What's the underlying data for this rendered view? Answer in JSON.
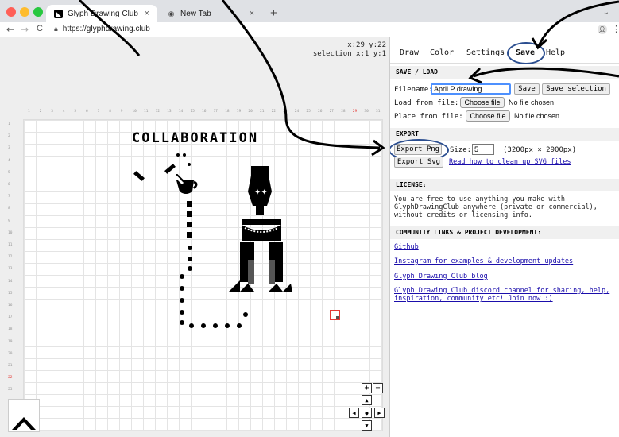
{
  "browser": {
    "tabs": [
      {
        "label": "Glyph Drawing Club",
        "active": true,
        "close": "×"
      },
      {
        "label": "New Tab",
        "active": false,
        "close": "×"
      }
    ],
    "new_tab": "+",
    "tab_chevron": "⌄",
    "url": "https://glyphdrawing.club",
    "nav": {
      "back": "←",
      "forward": "→",
      "reload": "C"
    },
    "icons": [
      "lock-icon",
      "profile-icon",
      "kebab-menu-icon"
    ]
  },
  "canvas": {
    "cursor_line1": "x:29 y:22",
    "cursor_line2": "selection x:1 y:1",
    "highlight_column": "29",
    "highlight_row": "22",
    "title": "COLLABORATION",
    "zoom_in": "+",
    "zoom_out": "−",
    "pan": {
      "up": "▲",
      "down": "▼",
      "left": "◀",
      "right": "▶",
      "center": "●"
    },
    "grid_cols": 31,
    "grid_rows": 26
  },
  "panel": {
    "tabs": [
      "Draw",
      "Color",
      "Settings",
      "Save",
      "Help"
    ],
    "active_tab": "Save",
    "save_load": {
      "heading": "SAVE / LOAD",
      "filename_label": "Filename:",
      "filename_value": "April P drawing",
      "save_button": "Save",
      "save_selection_button": "Save selection",
      "load_label": "Load from file:",
      "place_label": "Place from file:",
      "choose_file": "Choose file",
      "no_file": "No file chosen"
    },
    "export": {
      "heading": "EXPORT",
      "export_png": "Export Png",
      "size_label": "Size:",
      "size_value": "5",
      "size_note": "(3200px × 2900px)",
      "export_svg": "Export Svg",
      "svg_link": "Read how to clean up SVG files"
    },
    "license": {
      "heading": "LICENSE:",
      "text": "You are free to use anything you make with GlyphDrawingClub anywhere (private or commercial), without credits or licensing info."
    },
    "community": {
      "heading": "COMMUNITY LINKS & PROJECT DEVELOPMENT:",
      "links": [
        "Github",
        "Instagram for examples & development updates",
        "Glyph Drawing Club blog",
        "Glyph Drawing Club discord channel for sharing, help, inspiration, community etc! Join now :)"
      ]
    }
  },
  "colors": {
    "circle": "#2a4d8f",
    "highlight": "#e53935",
    "link": "#1a0dab"
  }
}
